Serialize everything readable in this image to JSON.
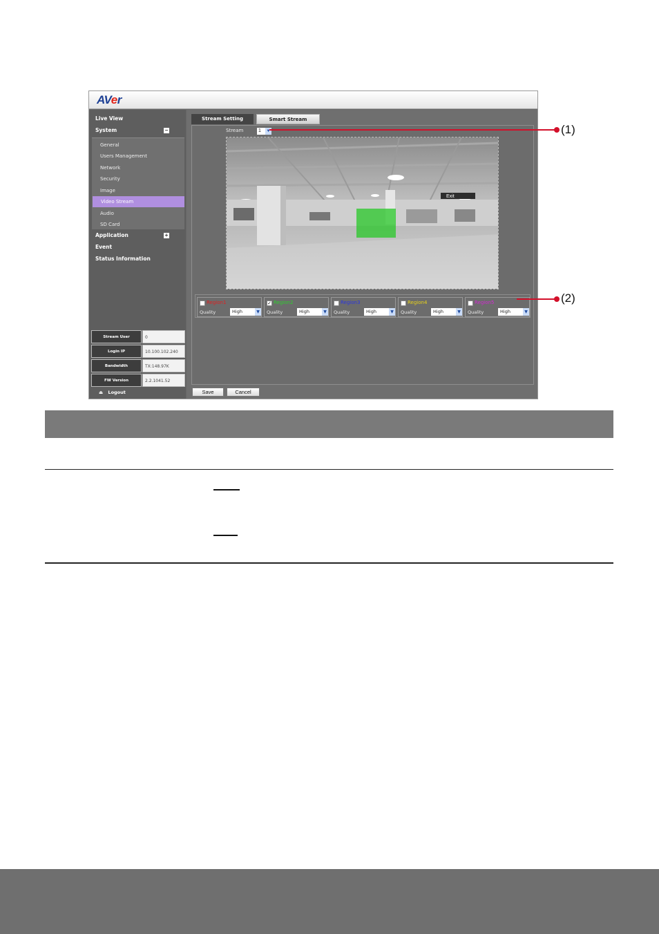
{
  "app": {
    "logo": "AVer"
  },
  "sidebar": {
    "items": [
      {
        "label": "Live View"
      },
      {
        "label": "System",
        "toggle": "−"
      },
      {
        "label": "Application",
        "toggle": "+"
      },
      {
        "label": "Event"
      },
      {
        "label": "Status Information"
      }
    ],
    "system_subitems": [
      "General",
      "Users Management",
      "Network",
      "Security",
      "Image",
      "Video Stream",
      "Audio",
      "SD Card"
    ],
    "active_subitem": "Video Stream",
    "info": [
      {
        "label": "Stream User",
        "value": "0"
      },
      {
        "label": "Login IP",
        "value": "10.100.102.240"
      },
      {
        "label": "Bandwidth",
        "value": "TX:148.97K"
      },
      {
        "label": "FW Version",
        "value": "2.2.1041.52"
      }
    ],
    "logout": "Logout"
  },
  "tabs": [
    {
      "label": "Stream Setting"
    },
    {
      "label": "Smart Stream"
    }
  ],
  "stream": {
    "label": "Stream",
    "value": "1"
  },
  "video": {
    "exit_sign": "Exit"
  },
  "regions": [
    {
      "name": "Region1",
      "color": "#e02020",
      "checked": false,
      "quality_label": "Quality",
      "quality": "High"
    },
    {
      "name": "Region2",
      "color": "#2fcf2f",
      "checked": true,
      "quality_label": "Quality",
      "quality": "High"
    },
    {
      "name": "Region3",
      "color": "#2a35e0",
      "checked": false,
      "quality_label": "Quality",
      "quality": "High"
    },
    {
      "name": "Region4",
      "color": "#e8d21a",
      "checked": false,
      "quality_label": "Quality",
      "quality": "High"
    },
    {
      "name": "Region5",
      "color": "#d22bd2",
      "checked": false,
      "quality_label": "Quality",
      "quality": "High"
    }
  ],
  "buttons": {
    "save": "Save",
    "cancel": "Cancel"
  },
  "callouts": [
    {
      "label": "(1)"
    },
    {
      "label": "(2)"
    }
  ],
  "colors": {
    "callout": "#d3102a",
    "active_nav": "#b08fe0",
    "header_band": "#7a7a7a"
  }
}
